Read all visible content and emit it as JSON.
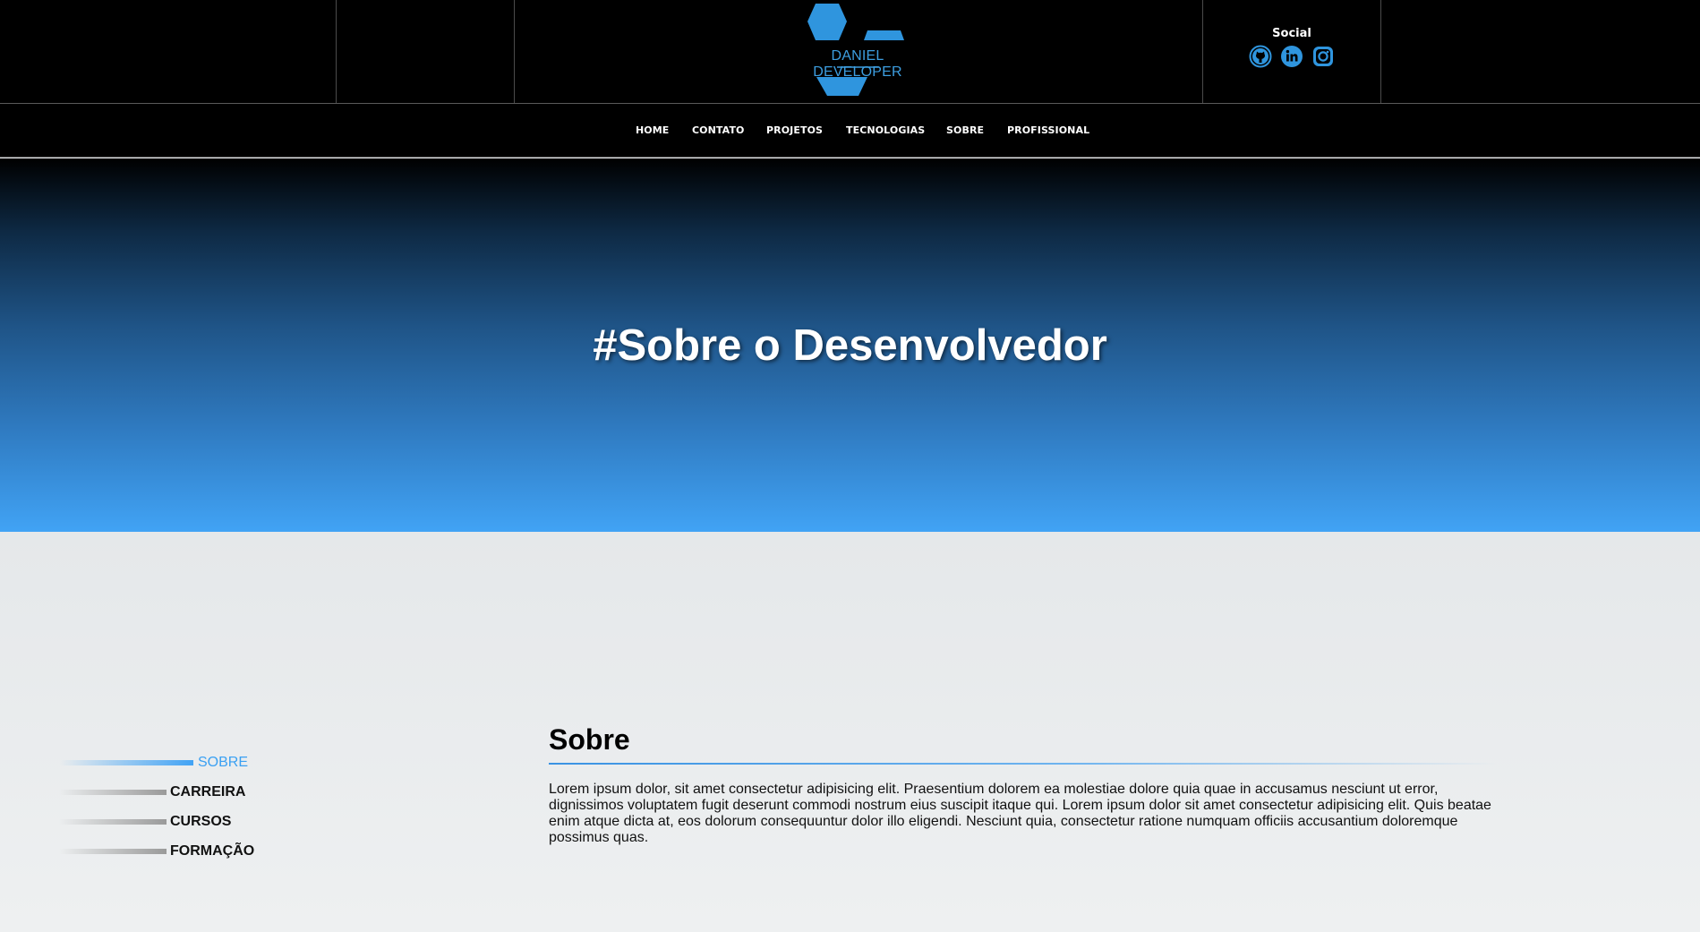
{
  "header": {
    "logo_text": "DANIEL DEVELOPER",
    "social_title": "Social",
    "social_icons": [
      "github-icon",
      "linkedin-icon",
      "instagram-icon"
    ],
    "accent_color": "#2f95de"
  },
  "nav": {
    "items": [
      "HOME",
      "CONTATO",
      "PROJETOS",
      "TECNOLOGIAS",
      "SOBRE",
      "PROFISSIONAL"
    ]
  },
  "hero": {
    "title": "#Sobre o Desenvolvedor",
    "gradient_top": "#000000",
    "gradient_bottom": "#41a3f5"
  },
  "sidebar": {
    "items": [
      {
        "label": "SOBRE",
        "active": true
      },
      {
        "label": "CARREIRA",
        "active": false
      },
      {
        "label": "CURSOS",
        "active": false
      },
      {
        "label": "FORMAÇÃO",
        "active": false
      }
    ],
    "active_color": "#3aa0f2"
  },
  "section": {
    "title": "Sobre",
    "text": "Lorem ipsum dolor, sit amet consectetur adipisicing elit. Praesentium dolorem ea molestiae dolore quia quae in accusamus nesciunt ut error, dignissimos voluptatem fugit deserunt commodi nostrum eius suscipit itaque qui. Lorem ipsum dolor sit amet consectetur adipisicing elit. Quis beatae enim atque dicta at, eos dolorum consequuntur dolor illo eligendi. Nesciunt quia, consectetur ratione numquam officiis accusantium doloremque possimus quas."
  }
}
